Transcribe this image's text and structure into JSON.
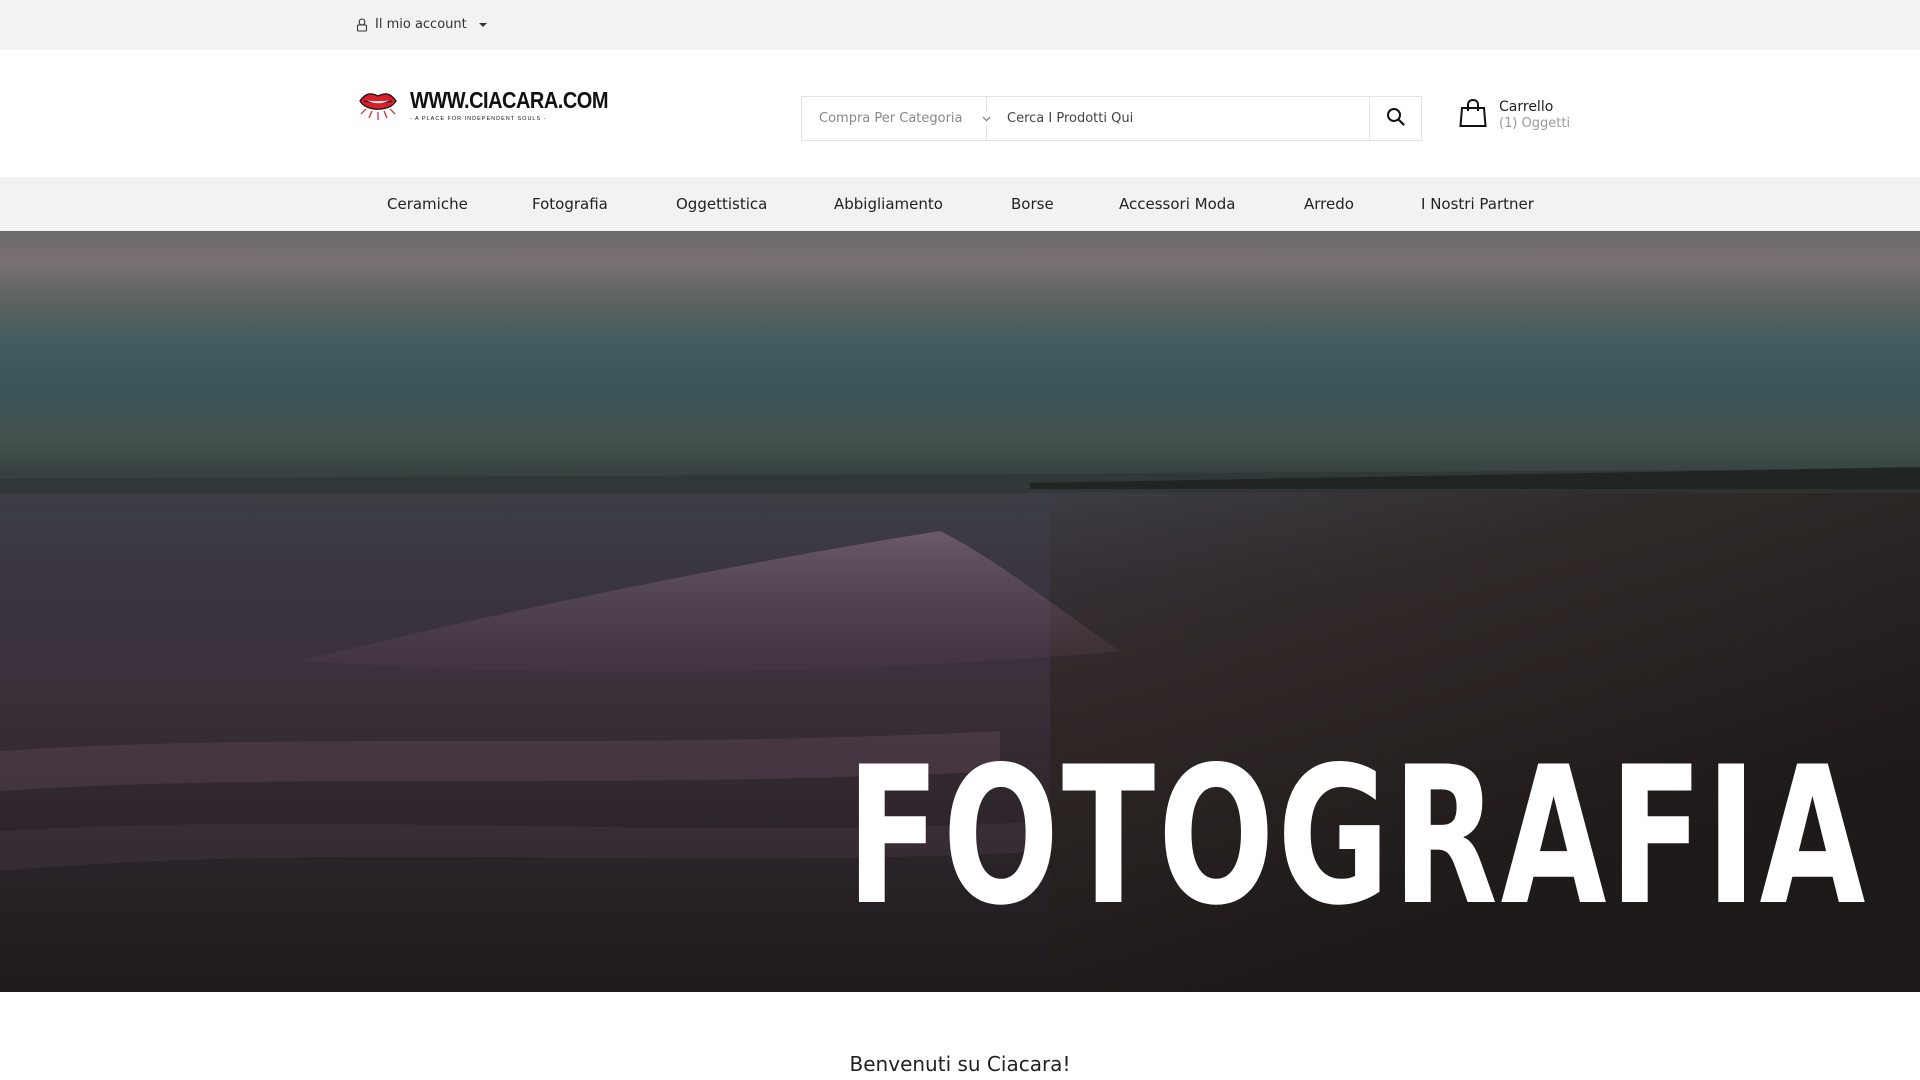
{
  "topbar": {
    "account_label": "Il mio account"
  },
  "brand": {
    "name": "WWW.CIACARA.COM",
    "tagline": "- A PLACE FOR INDEPENDENT SOULS -"
  },
  "search": {
    "category_label": "Compra Per Categoria",
    "placeholder": "Cerca I Prodotti Qui"
  },
  "cart": {
    "title": "Carrello",
    "count": "(1) Oggetti"
  },
  "nav": {
    "items": [
      {
        "label": "Ceramiche"
      },
      {
        "label": "Fotografia"
      },
      {
        "label": "Oggettistica"
      },
      {
        "label": "Abbigliamento"
      },
      {
        "label": "Borse"
      },
      {
        "label": "Accessori Moda"
      },
      {
        "label": "Arredo"
      },
      {
        "label": "I Nostri Partner"
      }
    ]
  },
  "hero": {
    "title": "FOTOGRAFIA"
  },
  "welcome": {
    "text": "Benvenuti su Ciacara!"
  },
  "colors": {
    "topbar_bg": "#f2f2f2",
    "nav_bg": "#f2f2f2",
    "logo_red": "#d8202a",
    "text": "#222222"
  }
}
